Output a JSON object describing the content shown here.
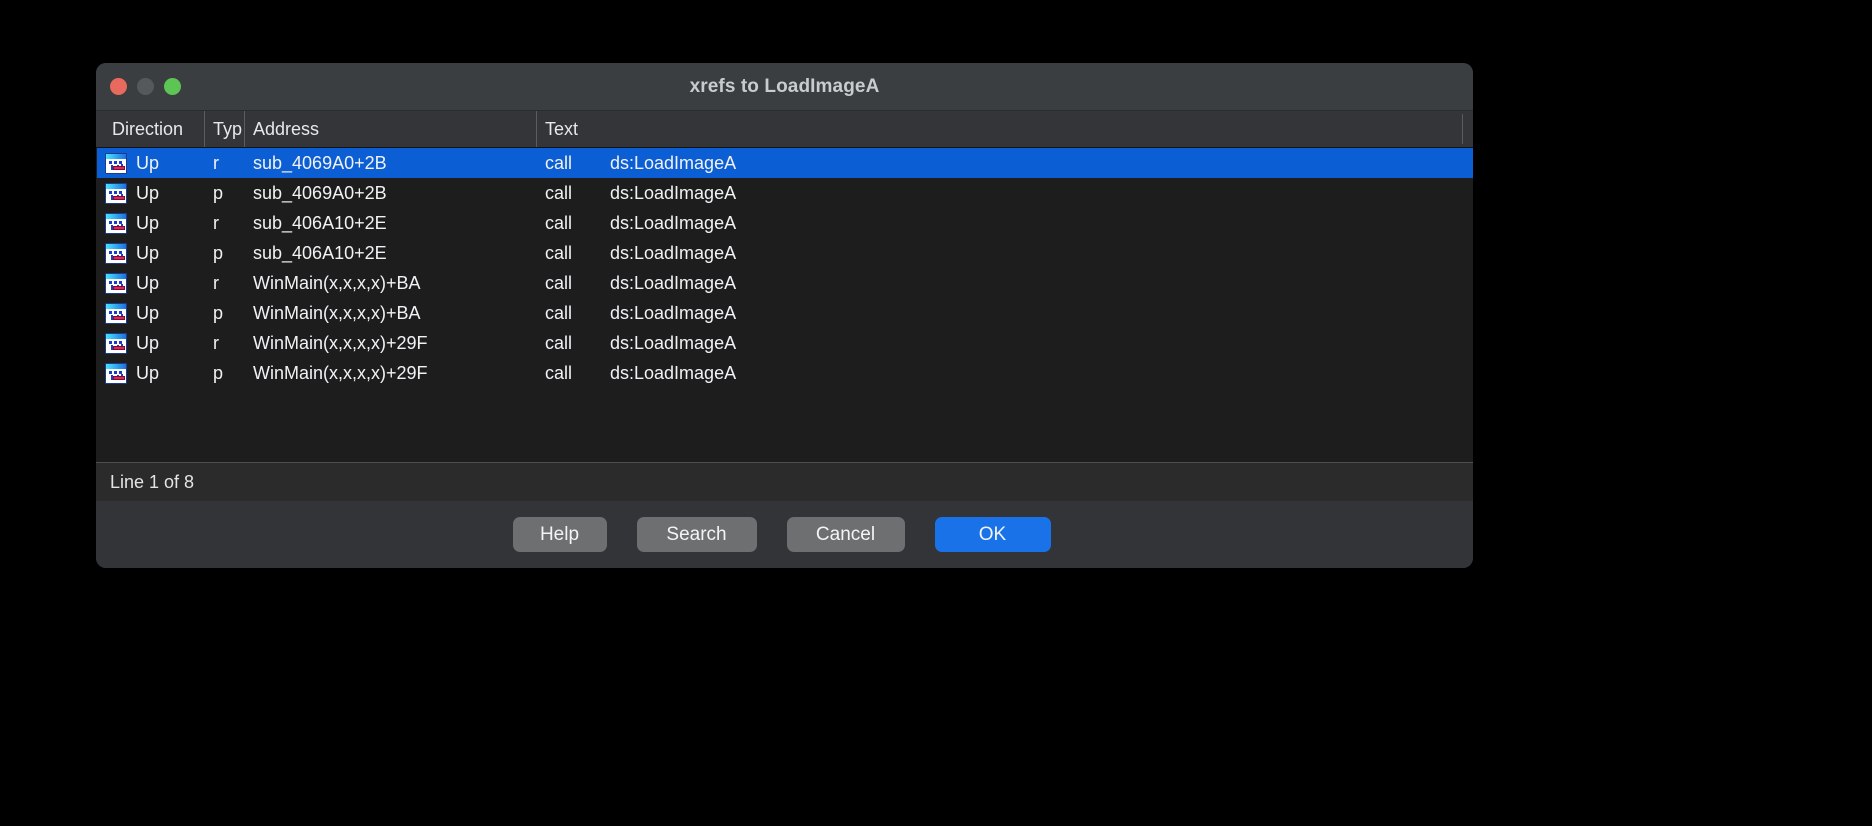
{
  "window": {
    "title": "xrefs to LoadImageA",
    "traffic_lights": [
      {
        "name": "close",
        "color": "#e8695d"
      },
      {
        "name": "minimize",
        "color": "#56595c"
      },
      {
        "name": "zoom",
        "color": "#5dc553"
      }
    ]
  },
  "table": {
    "columns": [
      "Direction",
      "Typ",
      "Address",
      "Text"
    ],
    "rows": [
      {
        "icon": "ida-xref-icon",
        "direction": "Up",
        "type": "r",
        "address": "sub_4069A0+2B",
        "mnemonic": "call",
        "operand": "ds:LoadImageA",
        "selected": true
      },
      {
        "icon": "ida-xref-icon",
        "direction": "Up",
        "type": "p",
        "address": "sub_4069A0+2B",
        "mnemonic": "call",
        "operand": "ds:LoadImageA",
        "selected": false
      },
      {
        "icon": "ida-xref-icon",
        "direction": "Up",
        "type": "r",
        "address": "sub_406A10+2E",
        "mnemonic": "call",
        "operand": "ds:LoadImageA",
        "selected": false
      },
      {
        "icon": "ida-xref-icon",
        "direction": "Up",
        "type": "p",
        "address": "sub_406A10+2E",
        "mnemonic": "call",
        "operand": "ds:LoadImageA",
        "selected": false
      },
      {
        "icon": "ida-xref-icon",
        "direction": "Up",
        "type": "r",
        "address": "WinMain(x,x,x,x)+BA",
        "mnemonic": "call",
        "operand": "ds:LoadImageA",
        "selected": false
      },
      {
        "icon": "ida-xref-icon",
        "direction": "Up",
        "type": "p",
        "address": "WinMain(x,x,x,x)+BA",
        "mnemonic": "call",
        "operand": "ds:LoadImageA",
        "selected": false
      },
      {
        "icon": "ida-xref-icon",
        "direction": "Up",
        "type": "r",
        "address": "WinMain(x,x,x,x)+29F",
        "mnemonic": "call",
        "operand": "ds:LoadImageA",
        "selected": false
      },
      {
        "icon": "ida-xref-icon",
        "direction": "Up",
        "type": "p",
        "address": "WinMain(x,x,x,x)+29F",
        "mnemonic": "call",
        "operand": "ds:LoadImageA",
        "selected": false
      }
    ]
  },
  "status": {
    "line_info": "Line 1 of 8"
  },
  "buttons": {
    "help": "Help",
    "search": "Search",
    "cancel": "Cancel",
    "ok": "OK"
  },
  "colors": {
    "selection_blue": "#0b5ed4",
    "accent_blue": "#1a72e8",
    "window_chrome": "#323437",
    "list_background": "#1d1d1d",
    "button_gray": "#6d6f71"
  }
}
